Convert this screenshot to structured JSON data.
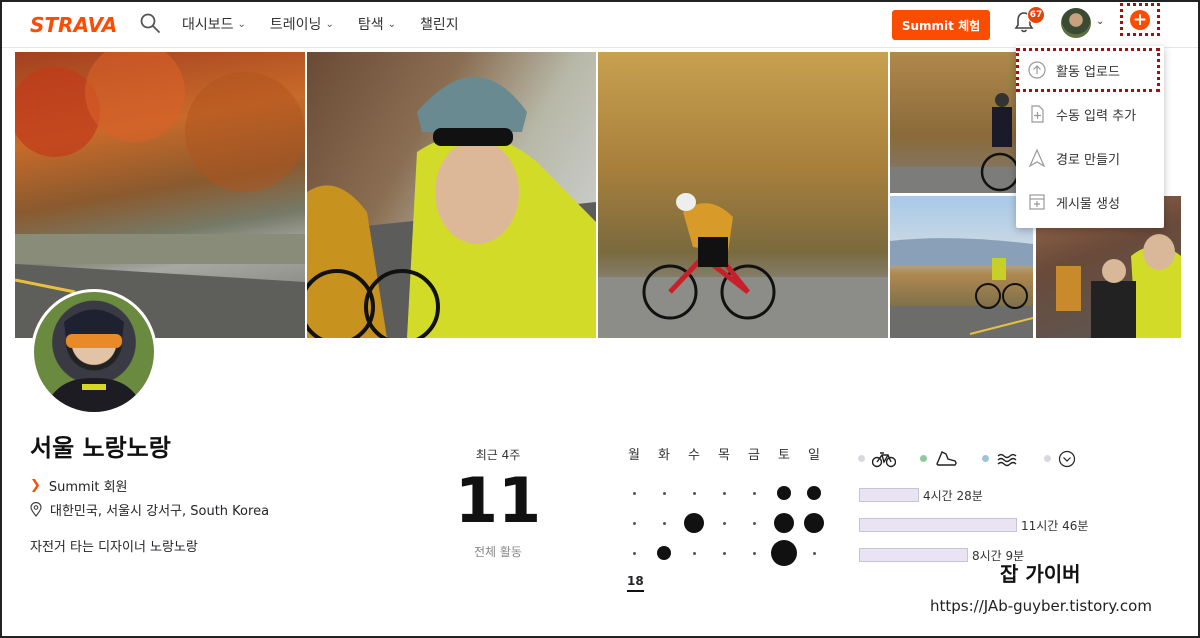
{
  "header": {
    "logo": "STRAVA",
    "nav": [
      "대시보드",
      "트레이닝",
      "탐색",
      "챌린지"
    ],
    "summit_button": "Summit 체험",
    "notification_count": "67"
  },
  "dropdown": {
    "items": [
      "활동 업로드",
      "수동 입력 추가",
      "경로 만들기",
      "게시물 생성"
    ]
  },
  "profile": {
    "name": "서울 노랑노랑",
    "summit": "Summit 회원",
    "location": "대한민국, 서울시 강서구, South Korea",
    "bio": "자전거 타는 디자이너 노랑노랑"
  },
  "stats": {
    "recent_label": "최근 4주",
    "activity_count": "11",
    "total_label": "전체 활동",
    "week_label": "18"
  },
  "weekdays": [
    "월",
    "화",
    "수",
    "목",
    "금",
    "토",
    "일"
  ],
  "activity_grid": [
    [
      0,
      0,
      0,
      0,
      0,
      2,
      2
    ],
    [
      0,
      0,
      3,
      0,
      0,
      3,
      3
    ],
    [
      0,
      2,
      0,
      0,
      0,
      4,
      0
    ]
  ],
  "sports": [
    "ride-icon",
    "run-icon",
    "swim-icon",
    "more-icon"
  ],
  "weekly_times": [
    {
      "label": "4시간 28분",
      "hours": 4.47
    },
    {
      "label": "11시간 46분",
      "hours": 11.77
    },
    {
      "label": "8시간 9분",
      "hours": 8.15
    }
  ],
  "watermark": {
    "title": "잡 가이버",
    "url": "https://JAb-guyber.tistory.com"
  },
  "colors": {
    "brand": "#fc4c02",
    "highlight": "#a00f12"
  }
}
